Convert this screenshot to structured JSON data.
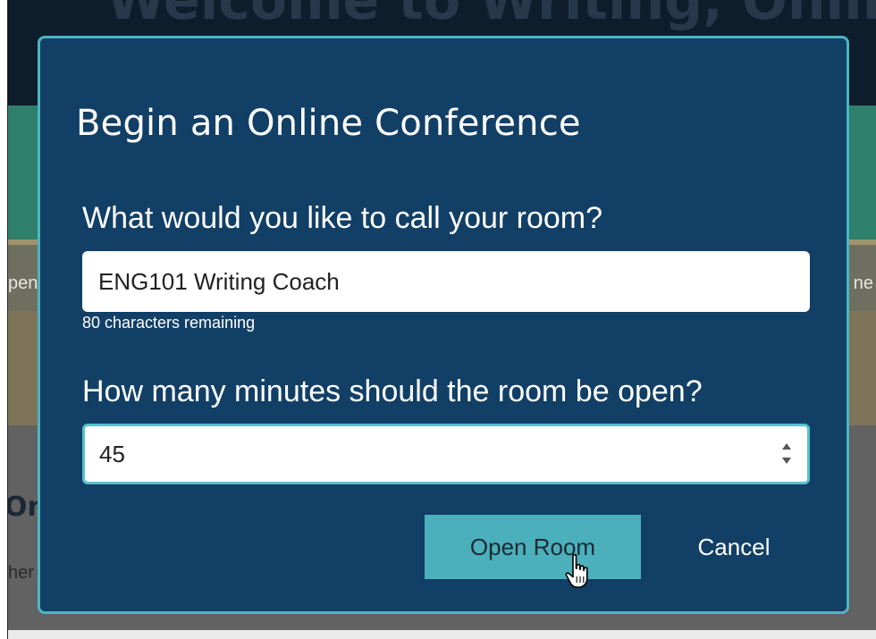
{
  "background": {
    "header_title": "Welcome to Writing, Online",
    "tab_left": "pen",
    "tab_right": "ne",
    "section_heading": "On",
    "section_text": "her"
  },
  "dialog": {
    "title": "Begin an Online Conference",
    "room_name": {
      "label": "What would you like to call your room?",
      "value": "ENG101 Writing Coach",
      "counter": "80 characters remaining"
    },
    "minutes": {
      "label": "How many minutes should the room be open?",
      "value": "45"
    },
    "buttons": {
      "open": "Open Room",
      "cancel": "Cancel"
    }
  },
  "colors": {
    "dialog_bg": "#123f66",
    "dialog_border": "#4bb5c1",
    "primary_button": "#4bb0bb"
  },
  "icons": [
    "spinner-up-icon",
    "spinner-down-icon",
    "hand-pointer-cursor-icon"
  ]
}
